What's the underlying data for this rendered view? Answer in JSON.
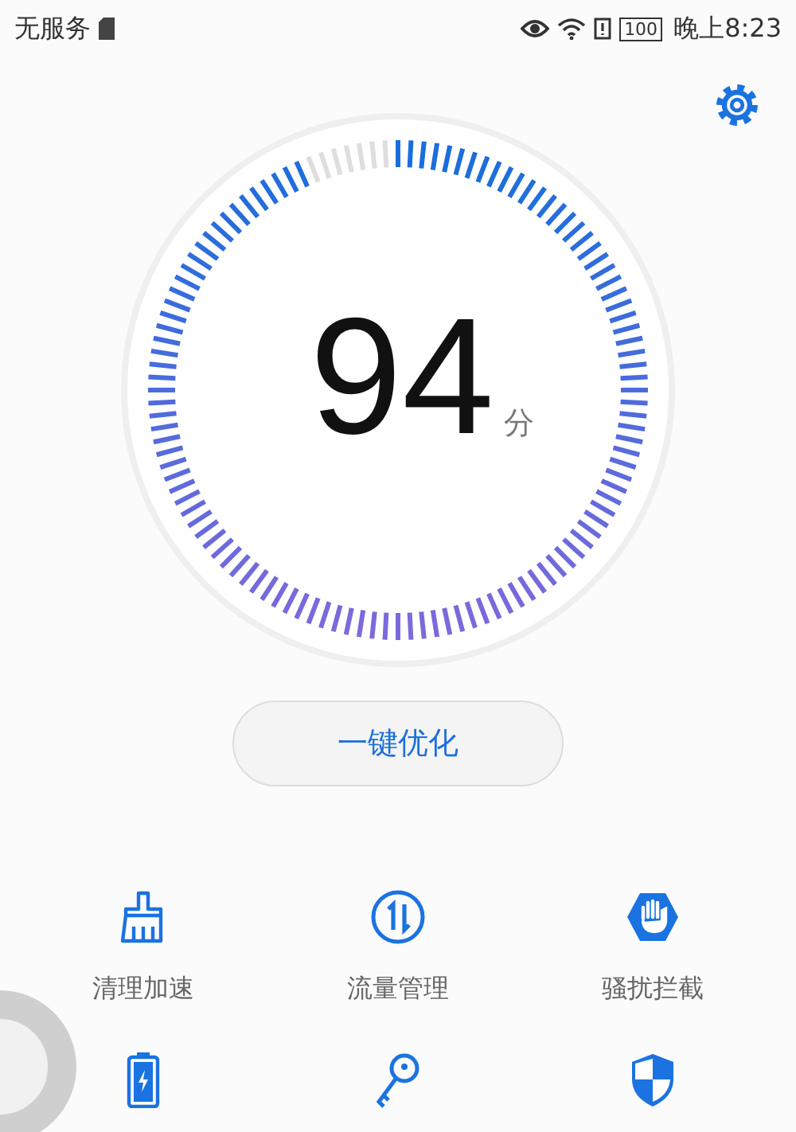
{
  "status_bar": {
    "carrier": "无服务",
    "battery": "100",
    "time": "晚上8:23"
  },
  "score": {
    "value": "94",
    "unit": "分"
  },
  "optimize_button": "一键优化",
  "tools": [
    {
      "kind": "broom",
      "label": "清理加速"
    },
    {
      "kind": "transfer",
      "label": "流量管理"
    },
    {
      "kind": "hand",
      "label": "骚扰拦截"
    },
    {
      "kind": "battery"
    },
    {
      "kind": "key"
    },
    {
      "kind": "shield"
    }
  ]
}
